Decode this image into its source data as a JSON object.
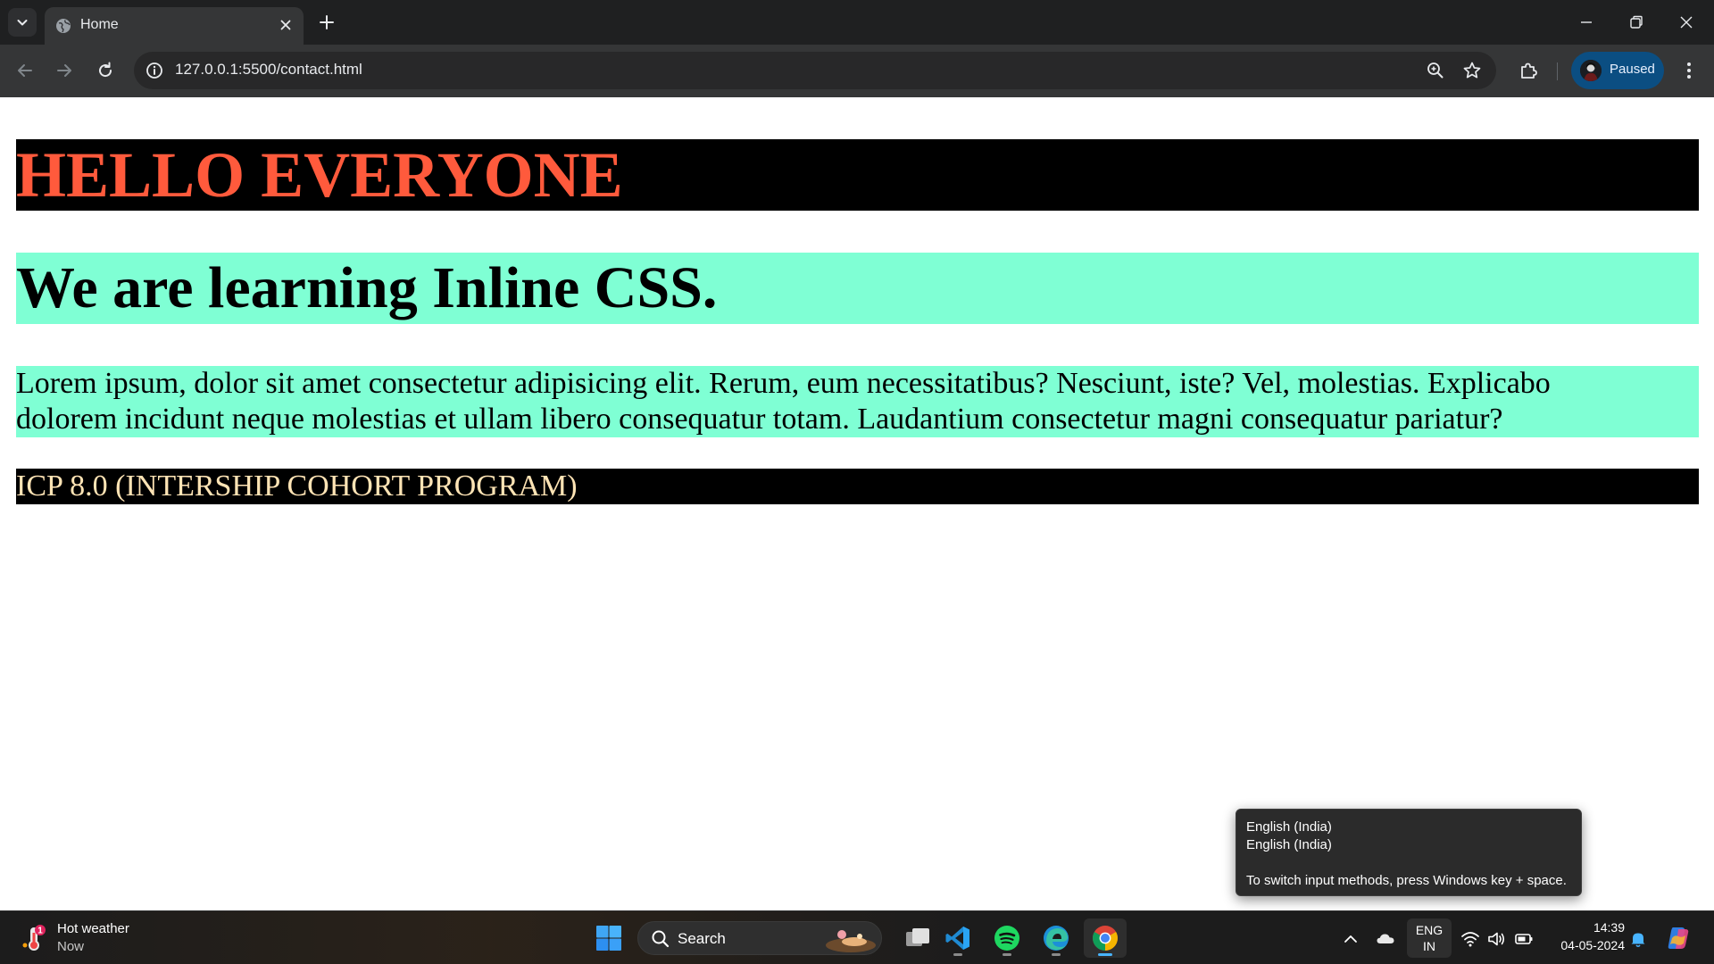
{
  "browser": {
    "tab_title": "Home",
    "url": "127.0.0.1:5500/contact.html",
    "profile_label": "Paused"
  },
  "page": {
    "heading1": "HELLO EVERYONE",
    "heading2": "We are learning Inline CSS.",
    "paragraph": "Lorem ipsum, dolor sit amet consectetur adipisicing elit. Rerum, eum necessitatibus? Nesciunt, iste? Vel, molestias. Explicabo dolorem incidunt neque molestias et ullam libero consequatur totam. Laudantium consectetur magni consequatur pariatur?",
    "footer_text": "ICP 8.0 (INTERSHIP COHORT PROGRAM)"
  },
  "tooltip": {
    "line1": "English (India)",
    "line2": "English (India)",
    "line3": "To switch input methods, press Windows key + space."
  },
  "taskbar": {
    "weather_title": "Hot weather",
    "weather_sub": "Now",
    "weather_badge": "1",
    "search_label": "Search",
    "lang_line1": "ENG",
    "lang_line2": "IN",
    "time": "14:39",
    "date": "04-05-2024"
  },
  "colors": {
    "heading1_text": "#ff5a3c",
    "heading_bg_dark": "#000000",
    "aquamarine_bg": "#7fffd4",
    "footer_text": "#ffe4b5",
    "profile_bg": "#0b4e82"
  },
  "icons": {
    "tab_search": "chevron-down-icon",
    "favicon": "globe-icon",
    "tab_close": "close-icon",
    "new_tab": "plus-icon",
    "back": "arrow-left-icon",
    "forward": "arrow-right-icon",
    "reload": "reload-icon",
    "site_info": "info-icon",
    "zoom": "zoom-icon",
    "bookmark": "star-icon",
    "extensions": "puzzle-icon",
    "menu": "kebab-menu-icon",
    "start": "windows-icon",
    "task_view": "task-view-icon",
    "vscode": "vscode-icon",
    "spotify": "spotify-icon",
    "edge": "edge-icon",
    "chrome": "chrome-icon",
    "wifi": "wifi-icon",
    "volume": "volume-icon",
    "battery": "battery-icon",
    "notifications": "bell-icon",
    "copilot": "copilot-icon"
  }
}
